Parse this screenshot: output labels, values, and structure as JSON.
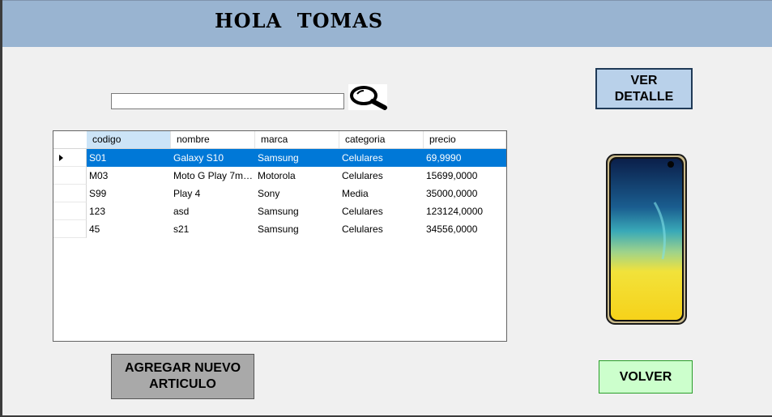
{
  "header": {
    "greeting": "HOLA  TOMAS"
  },
  "search": {
    "value": "",
    "placeholder": "",
    "icon": "magnifier-icon"
  },
  "grid": {
    "columns": [
      "codigo",
      "nombre",
      "marca",
      "categoria",
      "precio"
    ],
    "selected_row": 0,
    "rows": [
      [
        "S01",
        "Galaxy S10",
        "Samsung",
        "Celulares",
        "69,9990"
      ],
      [
        "M03",
        "Moto G Play 7ma ...",
        "Motorola",
        "Celulares",
        "15699,0000"
      ],
      [
        "S99",
        "Play 4",
        "Sony",
        "Media",
        "35000,0000"
      ],
      [
        "123",
        "asd",
        "Samsung",
        "Celulares",
        "123124,0000"
      ],
      [
        "45",
        "s21",
        "Samsung",
        "Celulares",
        "34556,0000"
      ]
    ]
  },
  "buttons": {
    "detail_line1": "VER",
    "detail_line2": "DETALLE",
    "add_line1": "AGREGAR NUEVO",
    "add_line2": "ARTICULO",
    "back": "VOLVER"
  },
  "colors": {
    "header": "#99b4d1",
    "selection": "#0078d7",
    "detail_button": "#b9d1ea",
    "add_button": "#a9a9a9",
    "back_button": "#ccffcc"
  }
}
